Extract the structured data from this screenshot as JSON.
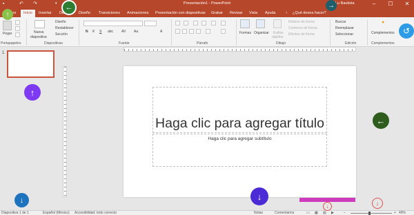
{
  "app": {
    "window_title": "Presentación1 - PowerPoint",
    "user_name": "Lu Bautista"
  },
  "title_controls": {
    "minimize": "–",
    "maximize": "☐",
    "close": "✕"
  },
  "tabs": [
    {
      "label": "Archivo"
    },
    {
      "label": "Inicio"
    },
    {
      "label": "Insertar"
    },
    {
      "label": "Dibujar"
    },
    {
      "label": "Diseño"
    },
    {
      "label": "Transiciones"
    },
    {
      "label": "Animaciones"
    },
    {
      "label": "Presentación con diapositivas"
    },
    {
      "label": "Grabar"
    },
    {
      "label": "Revisar"
    },
    {
      "label": "Vista"
    },
    {
      "label": "Ayuda"
    }
  ],
  "tell_me": "¿Qué desea hacer?",
  "ribbon": {
    "paste": "Pegar",
    "new_slide_line1": "Nueva",
    "new_slide_line2": "diapositiva",
    "layout": "Diseño",
    "reset": "Restablecer",
    "section": "Sección",
    "shapes": "Formas",
    "arrange": "Organizar",
    "quick_styles_line1": "Estilos",
    "quick_styles_line2": "rápidos",
    "shape_fill": "Relleno de forma",
    "shape_outline": "Contorno de forma",
    "shape_effects": "Efectos de forma",
    "find": "Buscar",
    "replace": "Reemplazar",
    "select": "Seleccionar",
    "addins": "Complementos",
    "format_buttons": [
      "N",
      "K",
      "S",
      "abc",
      "AV",
      "Aa",
      "A"
    ]
  },
  "ribbon_groups": {
    "clipboard": "Portapapeles",
    "slides": "Diapositivas",
    "font": "Fuente",
    "paragraph": "Párrafo",
    "drawing": "Dibujo",
    "editing": "Edición",
    "addins": "Complementos"
  },
  "slide_panel": {
    "slide_number": "1"
  },
  "slide": {
    "title_placeholder": "Haga clic para agregar título",
    "subtitle_placeholder": "Haga clic para agregar subtítulo"
  },
  "statusbar": {
    "slide_counter": "Diapositiva 1 de 1",
    "language": "Español (México)",
    "accessibility": "Accesibilidad: todo correcto",
    "notes": "Notas",
    "comments": "Comentarios",
    "zoom": "49%"
  },
  "overlay": {
    "colors": {
      "lightgreen": "#8bc34a",
      "darkgreen": "#2e7d32",
      "purple": "#7e3af2",
      "indigo": "#4a2bd6",
      "blue": "#1e73be",
      "skyblue": "#2e9be6",
      "teal": "#1f5f6b",
      "pink": "#cf3bbd",
      "red": "#e05050"
    }
  }
}
